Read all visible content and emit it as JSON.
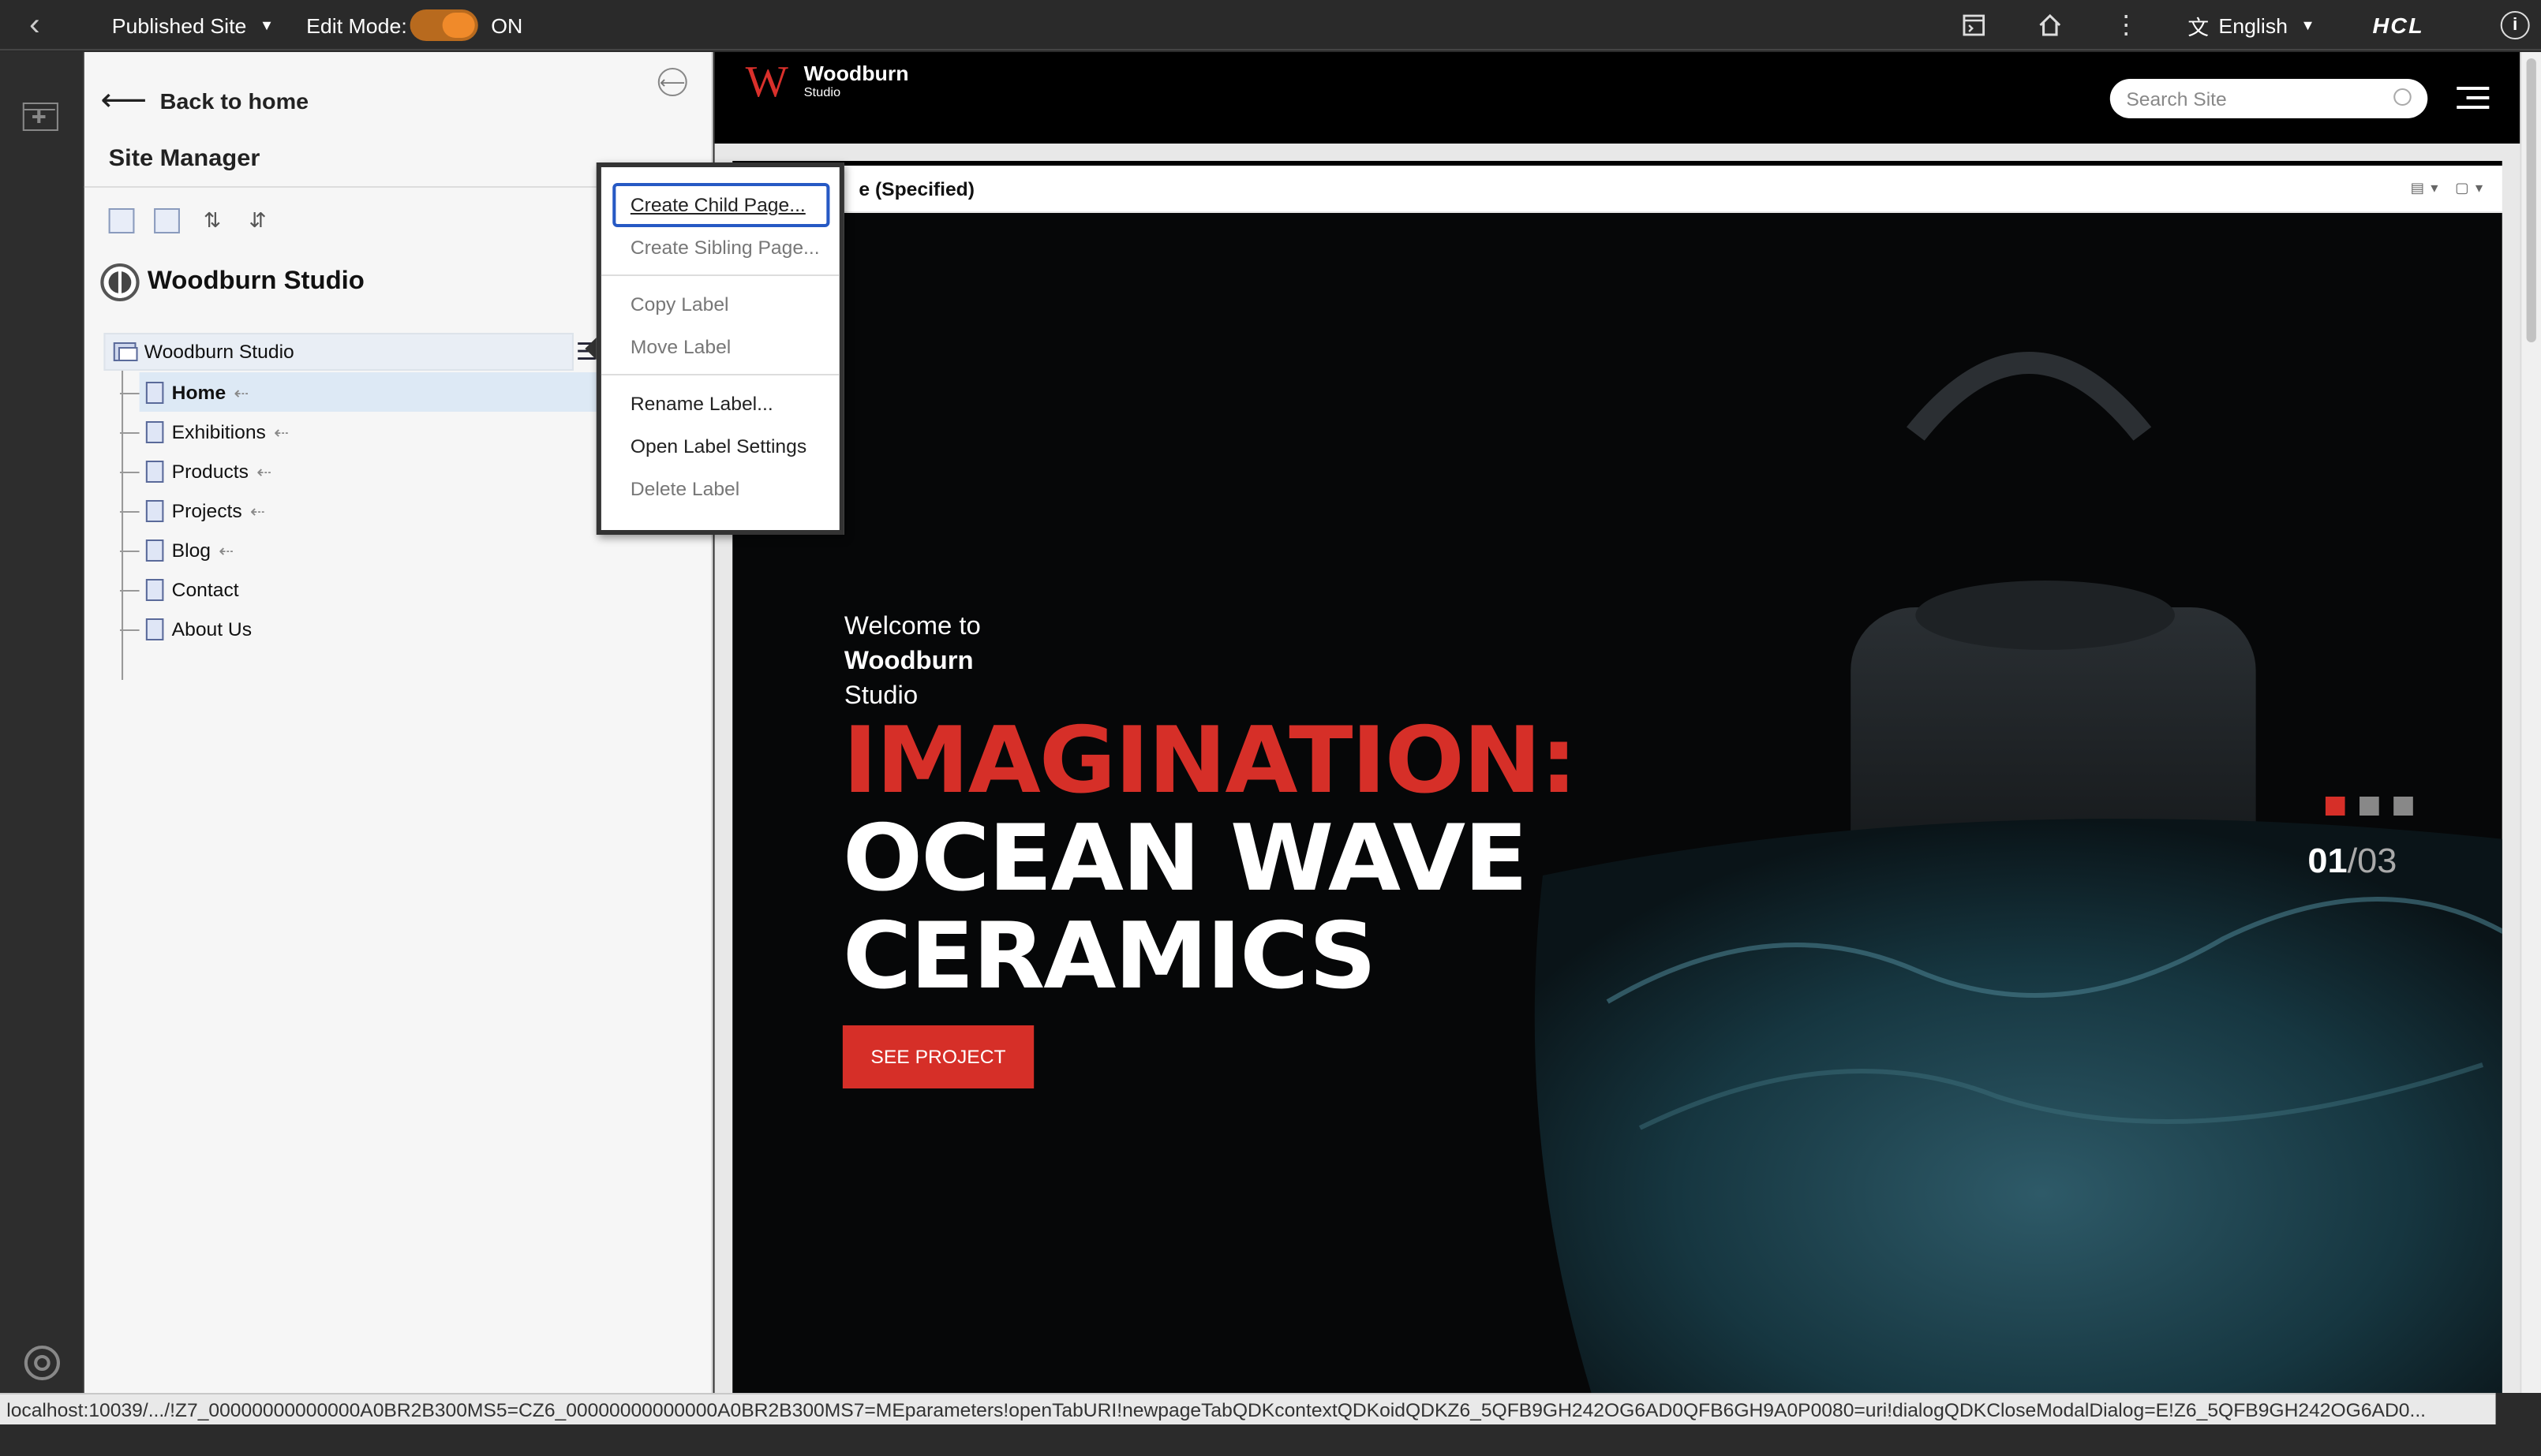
{
  "topbar": {
    "back_label": "‹",
    "site_select": "Published Site",
    "edit_mode_label": "Edit Mode:",
    "edit_mode_state": "ON",
    "language": "English",
    "brand": "HCL"
  },
  "site_manager": {
    "back_label": "Back to home",
    "title": "Site Manager",
    "site_name": "Woodburn Studio",
    "tree_root": "Woodburn Studio",
    "pages": [
      {
        "label": "Home",
        "arrow": "⇠"
      },
      {
        "label": "Exhibitions",
        "arrow": "⇠"
      },
      {
        "label": "Products",
        "arrow": "⇠"
      },
      {
        "label": "Projects",
        "arrow": "⇠"
      },
      {
        "label": "Blog",
        "arrow": "⇠"
      },
      {
        "label": "Contact",
        "arrow": ""
      },
      {
        "label": "About Us",
        "arrow": ""
      }
    ]
  },
  "context_menu": {
    "items": [
      "Create Child Page...",
      "Create Sibling Page...",
      "Copy Label",
      "Move Label",
      "Rename Label...",
      "Open Label Settings",
      "Delete Label"
    ]
  },
  "preview": {
    "logo_letter": "W",
    "logo_name": "Woodburn",
    "logo_sub": "Studio",
    "search_placeholder": "Search Site",
    "portlet_title": "e (Specified)",
    "welcome_line1": "Welcome to",
    "welcome_line2": "Woodburn",
    "welcome_line3": "Studio",
    "headline_red": "IMAGINATION:",
    "headline_line2": "OCEAN WAVE",
    "headline_line3": "CERAMICS",
    "cta": "SEE PROJECT",
    "slide_current": "01",
    "slide_total": "/03",
    "slide_active_index": 0
  },
  "status_url": "localhost:10039/.../!Z7_00000000000000A0BR2B300MS5=CZ6_00000000000000A0BR2B300MS7=MEparameters!openTabURI!newpageTabQDKcontextQDKoidQDKZ6_5QFB9GH242OG6AD0QFB6GH9A0P0080=uri!dialogQDKCloseModalDialog=E!Z6_5QFB9GH242OG6AD0...",
  "colors": {
    "accent_red": "#d62f28",
    "toggle_orange": "#f08a2a",
    "focus_blue": "#2659c4"
  }
}
